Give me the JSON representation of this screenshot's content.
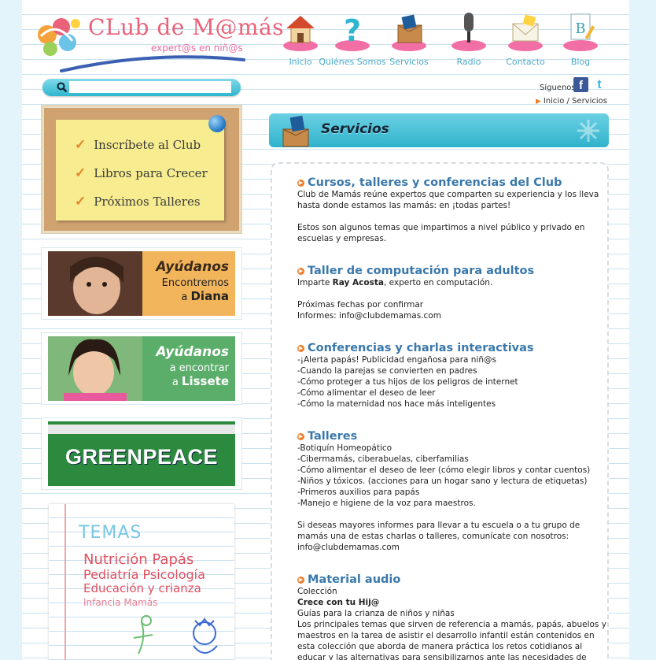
{
  "logo": {
    "title": "CLub de M@más",
    "tagline": "expert@s en niñ@s"
  },
  "nav": [
    {
      "label": "Inicio",
      "icon": "house-icon"
    },
    {
      "label": "Quiénes Somos",
      "icon": "question-mark-icon"
    },
    {
      "label": "Servicios",
      "icon": "box-icon"
    },
    {
      "label": "Radio",
      "icon": "microphone-icon"
    },
    {
      "label": "Contacto",
      "icon": "envelope-icon"
    },
    {
      "label": "Blog",
      "icon": "notebook-icon"
    }
  ],
  "search": {
    "placeholder": ""
  },
  "social": {
    "label": "Síguenos:",
    "facebook": "f",
    "twitter": "t"
  },
  "breadcrumb": {
    "home": "Inicio",
    "separator": "/",
    "current": "Servicios"
  },
  "sidebar": {
    "cork_items": [
      "Inscríbete al Club",
      "Libros para Crecer",
      "Próximos Talleres"
    ],
    "promos": [
      {
        "title": "Ayúdanos",
        "line": "Encontremos",
        "prefix": "a",
        "name": "Diana",
        "bg": "#f3b55c"
      },
      {
        "title": "Ayúdanos",
        "line": "a encontrar",
        "prefix": "a",
        "name": "Lissete",
        "bg": "#5aae6a"
      }
    ],
    "greenpeace": "GREENPEACE",
    "temas": {
      "heading": "TEMAS",
      "lines": [
        "Nutrición  Papás",
        "Pediatría Psicología",
        "Educación y crianza",
        "Infancia  Mamás"
      ]
    }
  },
  "services": {
    "header": "Servicios",
    "sections": [
      {
        "title": "Cursos, talleres y conferencias del Club",
        "lines": [
          "Club de Mamás reúne expertos que comparten su experiencia y los lleva",
          "hasta donde estamos las mamás: en ¡todas partes!",
          "",
          "Estos son algunos temas que impartimos a nivel público y privado en",
          "escuelas y empresas."
        ]
      },
      {
        "title": "Taller de computación para adultos",
        "intro_pre": "Imparte ",
        "intro_bold": "Ray Acosta",
        "intro_post": ", experto en computación.",
        "lines": [
          "",
          "Próximas fechas por confirmar",
          "Informes: info@clubdemamas.com"
        ]
      },
      {
        "title": "Conferencias y charlas interactivas",
        "lines": [
          "-¡Alerta papás! Publicidad engañosa para niñ@s",
          "-Cuando la parejas se convierten en padres",
          "-Cómo proteger a tus hijos de los peligros de internet",
          "-Cómo alimentar el deseo de leer",
          "-Cómo la maternidad nos hace más inteligentes"
        ]
      },
      {
        "title": "Talleres",
        "lines": [
          "-Botiquín Homeopático",
          "-Cibermamás, ciberabuelas, ciberfamilias",
          "-Cómo alimentar el deseo de leer (cómo elegir libros y contar cuentos)",
          "-Niños y tóxicos. (acciones para un hogar sano y lectura de etiquetas)",
          "-Primeros auxilios para papás",
          "-Manejo e higiene de la voz para maestros.",
          "",
          "Si deseas mayores informes para llevar a tu escuela o a tu grupo de",
          "mamás una de estas charlas o talleres, comunícate con nosotros:",
          "info@clubdemamas.com"
        ]
      },
      {
        "title": "Material audio",
        "lines": [
          "Colección"
        ],
        "bold": "Crece con tu Hij@",
        "lines2": [
          "Guías para la crianza de niños y niñas",
          "Los principales temas que sirven de referencia a mamás, papás, abuelos y",
          "maestros en la tarea de asistir el desarrollo infantil están contenidos en",
          "esta colección que aborda de manera práctica los retos cotidianos al",
          "educar y las alternativas para sensibilizarnos ante las necesidades de"
        ]
      }
    ]
  }
}
